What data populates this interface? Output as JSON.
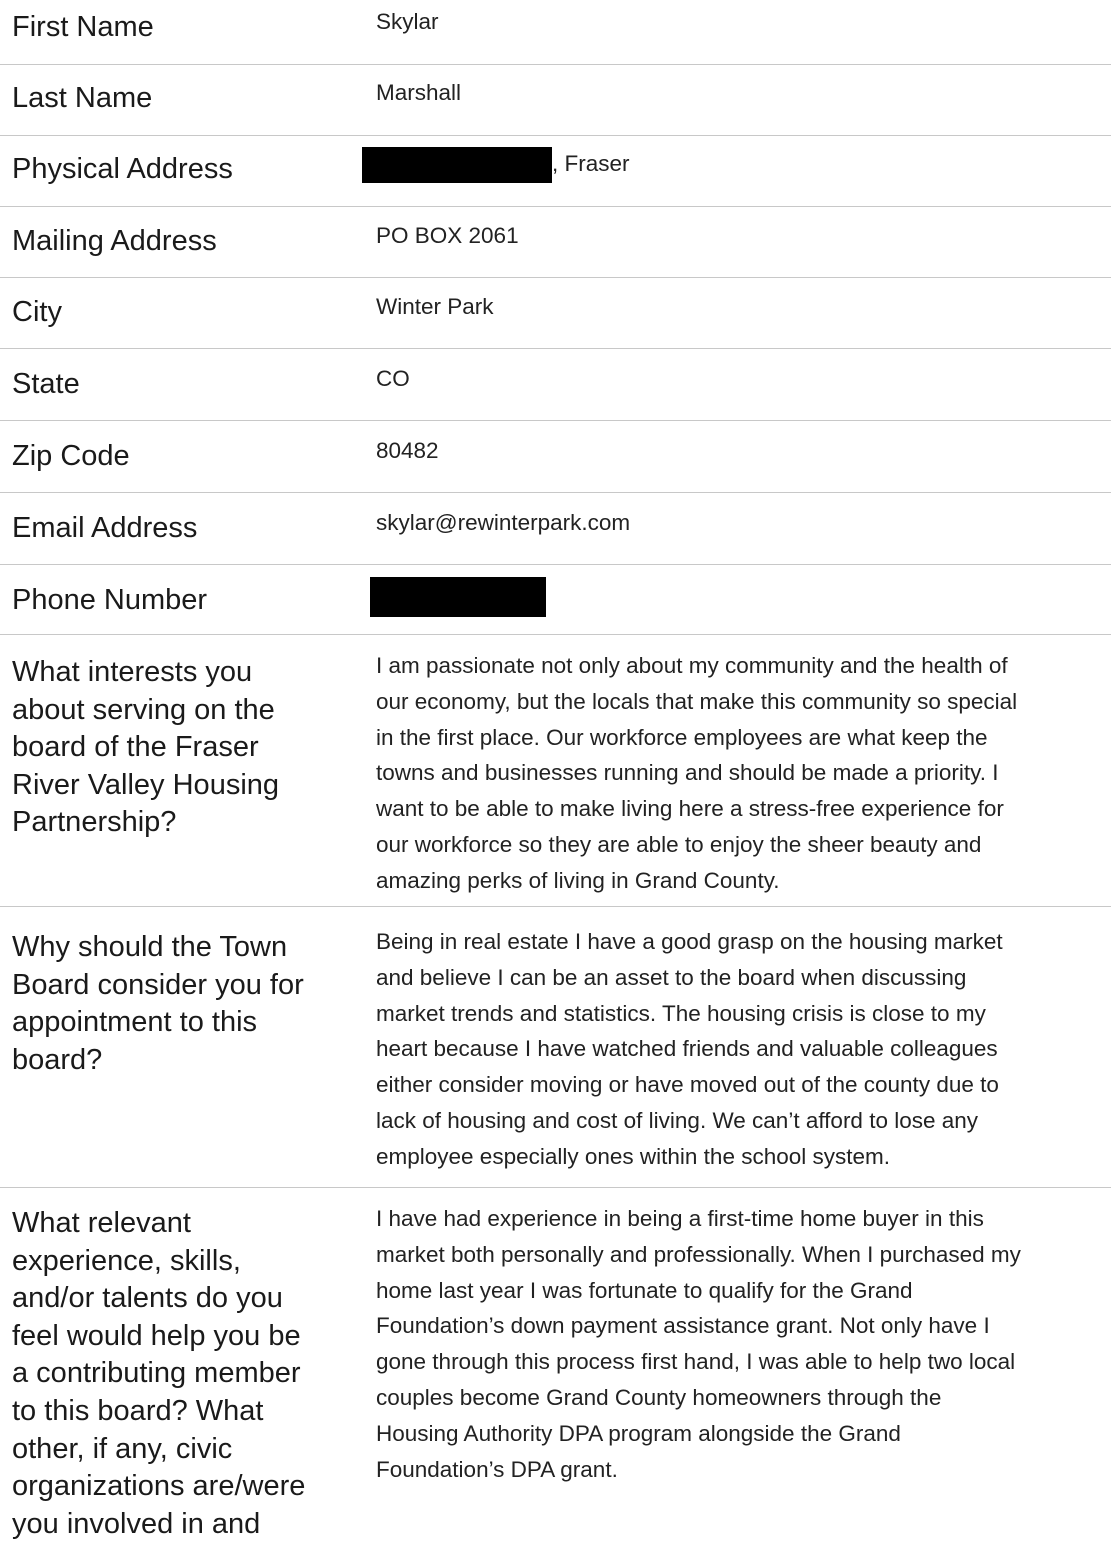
{
  "fields": {
    "first_name": {
      "label": "First Name",
      "value": "Skylar"
    },
    "last_name": {
      "label": "Last Name",
      "value": "Marshall"
    },
    "physical_address": {
      "label": "Physical Address",
      "value": ", Fraser"
    },
    "mailing_address": {
      "label": "Mailing Address",
      "value": "PO BOX 2061"
    },
    "city": {
      "label": "City",
      "value": "Winter Park"
    },
    "state": {
      "label": "State",
      "value": "CO"
    },
    "zip": {
      "label": "Zip Code",
      "value": "80482"
    },
    "email": {
      "label": "Email Address",
      "value": "skylar@rewinterpark.com"
    },
    "phone": {
      "label": "Phone Number"
    }
  },
  "questions": [
    {
      "label_lines": [
        "What interests you",
        "about serving on the",
        "board of the Fraser",
        "River Valley Housing",
        "Partnership?"
      ],
      "answer_lines": [
        "I am passionate not only about my community and the health of",
        "our economy, but the locals that make this community so special",
        "in the first place. Our workforce employees are what keep the",
        "towns and businesses running and should be made a priority. I",
        "want to be able to make living here a stress-free experience for",
        "our workforce so they are able to enjoy the sheer beauty and",
        "amazing perks of living in Grand County."
      ]
    },
    {
      "label_lines": [
        "Why should the Town",
        "Board consider you for",
        "appointment to this",
        "board?"
      ],
      "answer_lines": [
        "Being in real estate I have a good grasp on the housing market",
        "and believe I can be an asset to the board when discussing",
        "market trends and statistics. The housing crisis is close to my",
        "heart because I have watched friends and valuable colleagues",
        "either consider moving or have moved out of the county due to",
        "lack of housing and cost of living. We can’t afford to lose any",
        "employee especially ones within the school system."
      ]
    },
    {
      "label_lines": [
        "What relevant",
        "experience, skills,",
        "and/or talents do you",
        "feel would help you be",
        "a contributing member",
        "to this board? What",
        "other, if any, civic",
        "organizations are/were",
        "you involved in and"
      ],
      "answer_lines": [
        "I have had experience in being a first-time home buyer in this",
        "market both personally and professionally. When I purchased my",
        "home last year I was fortunate to qualify for the Grand",
        "Foundation’s down payment assistance grant. Not only have I",
        "gone through this process first hand, I was able to help two local",
        "couples become Grand County homeowners through the",
        "Housing Authority DPA program alongside the Grand",
        "Foundation’s DPA grant."
      ]
    }
  ]
}
